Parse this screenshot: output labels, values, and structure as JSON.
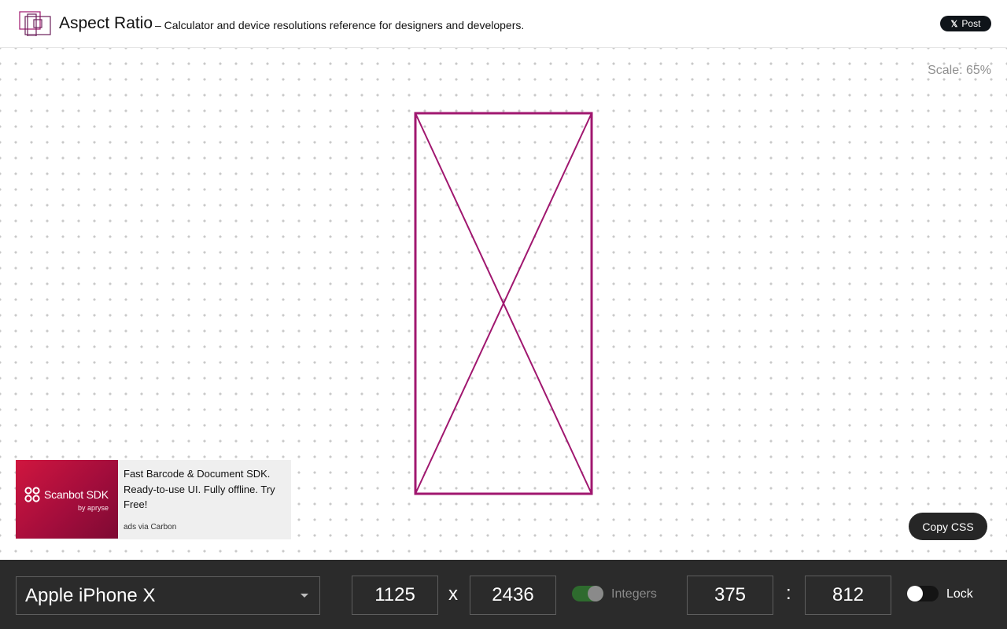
{
  "header": {
    "app_title": "Aspect Ratio",
    "tagline": "– Calculator and device resolutions reference for designers and developers.",
    "post_button": {
      "icon": "x-logo-icon",
      "glyph": "𝕏",
      "label": "Post"
    }
  },
  "canvas": {
    "scale_label": "Scale: 65%",
    "preview_color": "#a0176f"
  },
  "ad": {
    "brand": "Scanbot SDK",
    "brand_sub": "by apryse",
    "text": "Fast Barcode & Document SDK. Ready-to-use UI. Fully offline. Try Free!",
    "via": "ads via Carbon"
  },
  "actions": {
    "copy_css": "Copy CSS"
  },
  "controls": {
    "device": "Apple iPhone X",
    "width": "1125",
    "by": "x",
    "height": "2436",
    "integers_label": "Integers",
    "integers_enabled": true,
    "ratio_w": "375",
    "ratio_sep": ":",
    "ratio_h": "812",
    "lock_label": "Lock",
    "lock_enabled": false
  }
}
